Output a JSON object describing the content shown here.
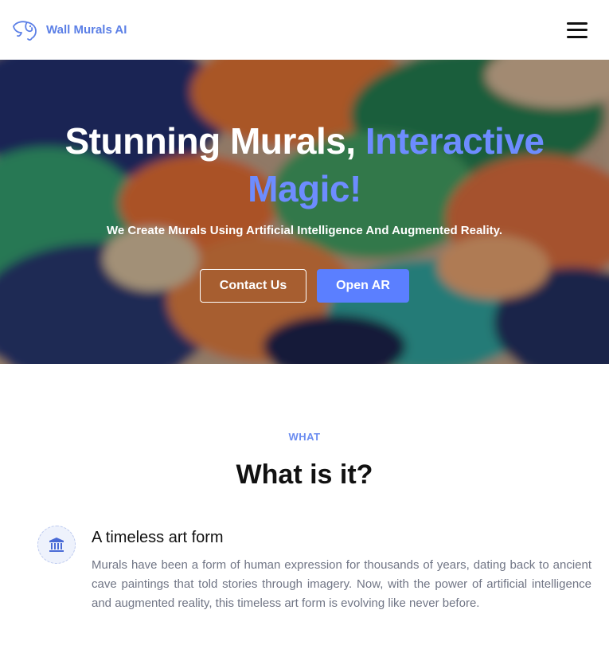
{
  "header": {
    "brand_name": "Wall Murals AI",
    "logo_icon": "elephant-logo-icon",
    "menu_icon": "hamburger-menu-icon"
  },
  "hero": {
    "title_part1": "Stunning Murals,",
    "title_accent": "Interactive Magic!",
    "subtitle": "We Create Murals Using Artificial Intelligence And Augmented Reality.",
    "contact_label": "Contact Us",
    "open_ar_label": "Open AR",
    "accent_color": "#6d8cff",
    "primary_button_color": "#5b7fff"
  },
  "what": {
    "eyebrow": "WHAT",
    "title": "What is it?",
    "features": [
      {
        "icon": "museum-building-icon",
        "title": "A timeless art form",
        "text": "Murals have been a form of human expression for thousands of years, dating back to ancient cave paintings that told stories through imagery. Now, with the power of artificial intelligence and augmented reality, this timeless art form is evolving like never before."
      }
    ]
  }
}
